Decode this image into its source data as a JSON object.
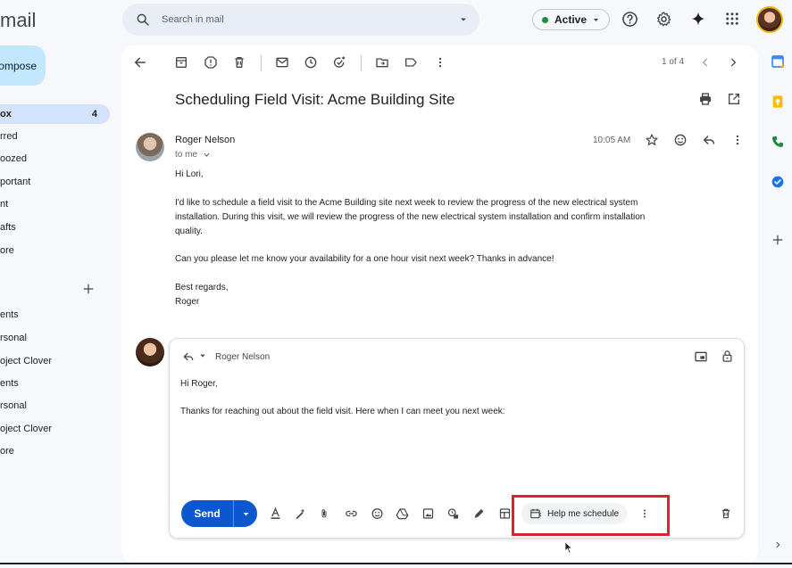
{
  "app": {
    "logo_text": "mail"
  },
  "search": {
    "placeholder": "Search in mail"
  },
  "status": {
    "label": "Active",
    "color": "#1e8e3e"
  },
  "nav": {
    "compose_label": "ompose",
    "items": [
      {
        "label": "ox",
        "count": "4"
      },
      {
        "label": "rred"
      },
      {
        "label": "oozed"
      },
      {
        "label": "portant"
      },
      {
        "label": "nt"
      },
      {
        "label": "afts"
      },
      {
        "label": "ore"
      }
    ],
    "labels": [
      {
        "label": "ents"
      },
      {
        "label": "rsonal"
      },
      {
        "label": "oject Clover"
      },
      {
        "label": "ents"
      },
      {
        "label": "rsonal"
      },
      {
        "label": "oject Clover"
      },
      {
        "label": "ore"
      }
    ]
  },
  "toolbar": {
    "pagination": "1 of 4"
  },
  "email": {
    "subject": "Scheduling Field Visit: Acme Building Site",
    "sender": "Roger Nelson",
    "recipient": "to me",
    "time": "10:05 AM",
    "greeting": "Hi Lori,",
    "paragraph1_line1": "I'd like to schedule a field visit to the Acme Building site next week to review the progress of the new electrical system",
    "paragraph1_line2": "installation. During this visit, we will review the progress of the new electrical system installation and confirm installation",
    "paragraph1_line3": "quality.",
    "paragraph2": "Can you please let me know your availability for a one hour visit next week? Thanks in advance!",
    "signoff": "Best regards,",
    "signature": "Roger"
  },
  "reply": {
    "to": "Roger Nelson",
    "greeting": "Hi Roger,",
    "body": "Thanks for reaching out about the field visit. Here when I can meet you next week:",
    "send_label": "Send",
    "help_schedule_label": "Help me schedule"
  },
  "colors": {
    "accent": "#0b57d0",
    "highlight": "#d9242a",
    "nav_active": "#d3e3fd",
    "compose": "#c2e7ff"
  }
}
